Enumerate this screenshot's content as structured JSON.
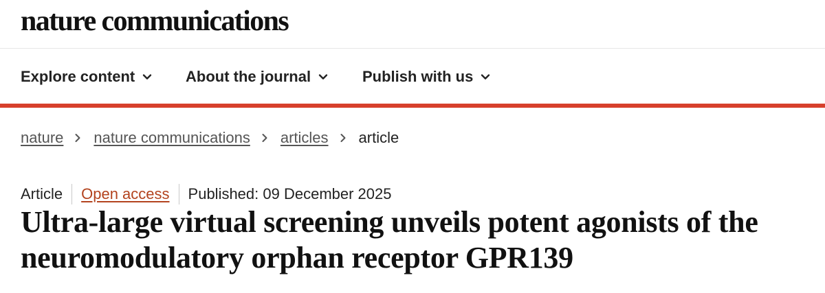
{
  "header": {
    "logo_text": "nature communications"
  },
  "nav": {
    "items": [
      {
        "label": "Explore content"
      },
      {
        "label": "About the journal"
      },
      {
        "label": "Publish with us"
      }
    ],
    "accent_color": "#d7402c"
  },
  "breadcrumb": {
    "items": [
      {
        "label": "nature"
      },
      {
        "label": "nature communications"
      },
      {
        "label": "articles"
      }
    ],
    "current": "article"
  },
  "article": {
    "type": "Article",
    "access": "Open access",
    "access_color": "#b3431e",
    "published": "Published: 09 December 2025",
    "title": "Ultra-large virtual screening unveils potent agonists of the neuromodulatory orphan receptor GPR139"
  }
}
